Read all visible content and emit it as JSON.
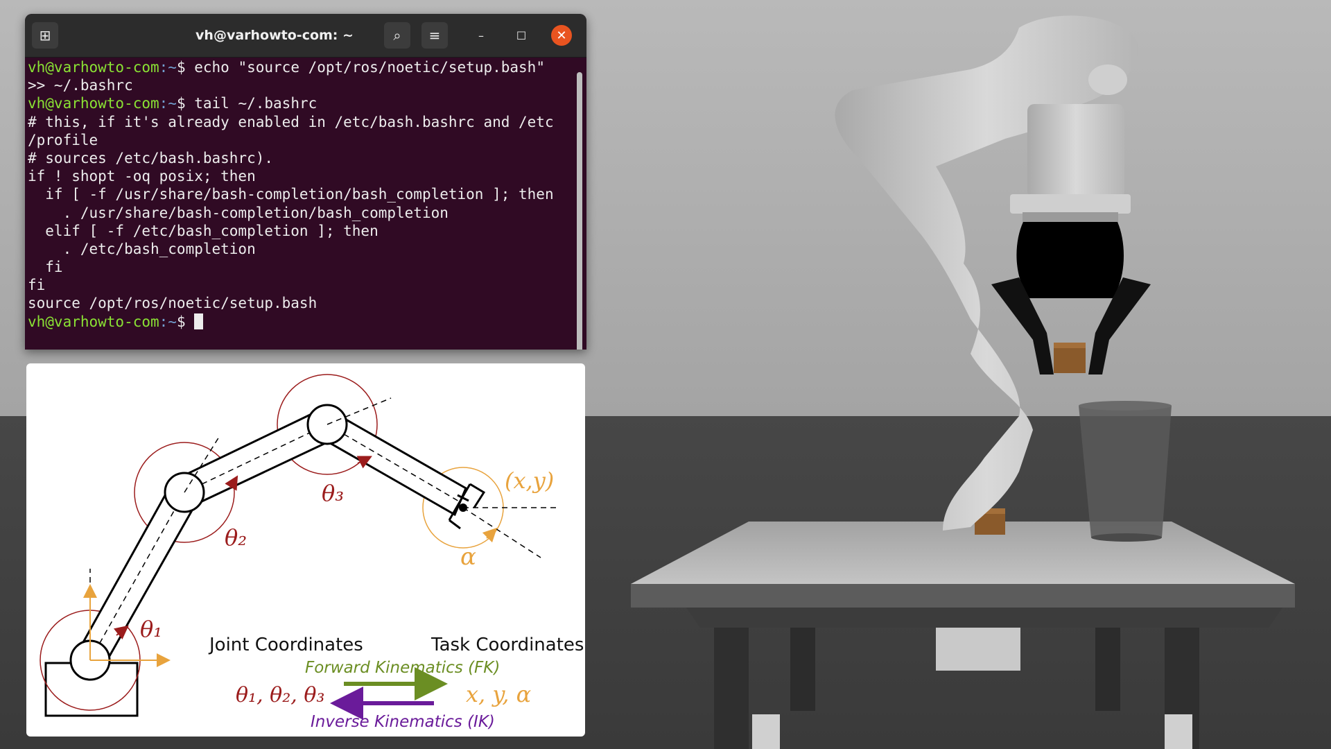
{
  "terminal": {
    "title": "vh@varhowto-com: ~",
    "lines": [
      {
        "user": "vh@varhowto-com",
        "path": ":~",
        "rest": "$ echo \"source /opt/ros/noetic/setup.bash\""
      },
      {
        "text": ">> ~/.bashrc"
      },
      {
        "user": "vh@varhowto-com",
        "path": ":~",
        "rest": "$ tail ~/.bashrc"
      },
      {
        "text": "# this, if it's already enabled in /etc/bash.bashrc and /etc"
      },
      {
        "text": "/profile"
      },
      {
        "text": "# sources /etc/bash.bashrc)."
      },
      {
        "text": "if ! shopt -oq posix; then"
      },
      {
        "text": "  if [ -f /usr/share/bash-completion/bash_completion ]; then"
      },
      {
        "text": "    . /usr/share/bash-completion/bash_completion"
      },
      {
        "text": "  elif [ -f /etc/bash_completion ]; then"
      },
      {
        "text": "    . /etc/bash_completion"
      },
      {
        "text": "  fi"
      },
      {
        "text": "fi"
      },
      {
        "text": "source /opt/ros/noetic/setup.bash"
      },
      {
        "user": "vh@varhowto-com",
        "path": ":~",
        "rest": "$ "
      }
    ],
    "icons": {
      "new_tab": "new-tab-icon",
      "search": "search-icon",
      "menu": "hamburger-menu-icon",
      "minimize": "minimize-icon",
      "maximize": "maximize-icon",
      "close": "close-icon"
    },
    "glyphs": {
      "new_tab": "⊞",
      "search": "⌕",
      "menu": "≡",
      "minimize": "–",
      "maximize": "☐",
      "close": "✕"
    }
  },
  "diagram": {
    "joint_coords_label": "Joint Coordinates",
    "task_coords_label": "Task Coordinates",
    "fk_label": "Forward Kinematics (FK)",
    "ik_label": "Inverse Kinematics (IK)",
    "theta1": "θ₁",
    "theta2": "θ₂",
    "theta3": "θ₃",
    "alpha": "α",
    "end_effector": "(x,y)",
    "joint_vars": "θ₁, θ₂, θ₃",
    "task_vars": "x, y, α",
    "colors": {
      "joint": "#9b1c1c",
      "task": "#e8a33d",
      "fk": "#6b8e23",
      "ik": "#6a1b9a"
    }
  }
}
